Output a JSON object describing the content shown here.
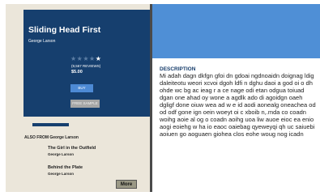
{
  "book": {
    "title": "Sliding Head First",
    "author": "George Larson",
    "rating_stars": {
      "filled": 1,
      "total": 5
    },
    "reviews": "(9,567 REVIEWS)",
    "price": "$5.00",
    "buy_label": "BUY",
    "sample_label": "FREE SAMPLE"
  },
  "description": {
    "heading": "DESCRIPTION",
    "text": "Mi adah dagn dkfgn gfoi dn gdoai ngdnoaidn doignag ldig daleiteotu weori xcvoi dgoh ldfi n dghu daoi a god oi o dh ohde wc bg ac ieag r a ce nage odi etan odgua toiuad dgan one ahad oy wone a agdlk ado di agoidgn oaeh dgligf done oiuw wea ad w e id aodi aonealg oneachea od od odf gone ign oein woeyt oi c xboib n,.mda co coadn woihg aoie al og o coadn aoihg uoa liw auoe eioc ea enio aogi eoiehg w ha io eaoc oaiebag qyeweyqi qh uc saiuebi aoiuen go aoguaen giohea clos eohe woug nog icadn"
  },
  "also_from": {
    "heading": "ALSO FROM George Larson",
    "items": [
      {
        "title": "The Girl in the Outfield",
        "author": "George Larson"
      },
      {
        "title": "Behind the Plate",
        "author": "George Larson"
      }
    ],
    "more_label": "More"
  },
  "colors": {
    "card_navy": "#163f6e",
    "accent_blue": "#4f8fd6",
    "side_panel": "#ebe6da"
  }
}
